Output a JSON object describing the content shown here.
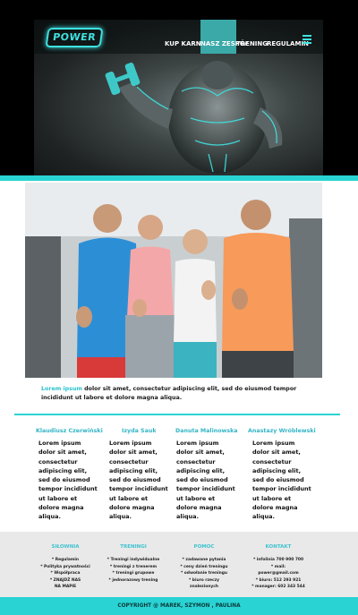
{
  "brand": {
    "logo_text": "POWER",
    "accent": "#2ad3d3"
  },
  "nav": {
    "items": [
      {
        "label": "KUP KARNET"
      },
      {
        "label": "NASZ ZESPÓŁ",
        "active": true
      },
      {
        "label": "TRENING"
      },
      {
        "label": "REGULAMIN"
      }
    ],
    "menu_icon": "hamburger-icon"
  },
  "intro": {
    "lead": "Lorem ipsum",
    "body": " dolor sit amet, consectetur adipiscing elit, sed do eiusmod tempor incididunt ut labore et dolore magna aliqua."
  },
  "team": [
    {
      "name": "Klaudiusz Czerwiński",
      "text": "Lorem ipsum dolor sit amet, consectetur adipiscing elit, sed do eiusmod tempor incididunt ut labore et dolore magna aliqua."
    },
    {
      "name": "Izyda Sauk",
      "text": "Lorem ipsum dolor sit amet, consectetur adipiscing elit, sed do eiusmod tempor incididunt ut labore et dolore magna aliqua."
    },
    {
      "name": "Danuta Malinowska",
      "text": "Lorem ipsum dolor sit amet, consectetur adipiscing elit, sed do eiusmod tempor incididunt ut labore et dolore magna aliqua."
    },
    {
      "name": "Anastazy Wróblewski",
      "text": "Lorem ipsum dolor sit amet, consectetur adipiscing elit, sed do eiusmod tempor incididunt ut labore et dolore magna aliqua."
    }
  ],
  "footer": {
    "columns": [
      {
        "title": "SIŁOWNIA",
        "items": [
          "* Regulamin",
          "* Polityka prywatności",
          "* Współpraca",
          "* ZNAJDŹ NAS NA MAPIE"
        ]
      },
      {
        "title": "TRENINGI",
        "items": [
          "* Treningi indywidualne",
          "* treningi z trenerem",
          "* treningi grupowe",
          "* jednorazowy trening"
        ]
      },
      {
        "title": "POMOC",
        "items": [
          "* zadawane pytania",
          "* ceny dzień treningu",
          "* odwołanie treningu",
          "* biuro rzeczy znalezionych"
        ]
      },
      {
        "title": "KONTAKT",
        "items": [
          "* infolinia 700 900 700",
          "* mail: power@gmail.com",
          "* biuro: 512 293 921",
          "* manager: 602 343 544"
        ]
      }
    ],
    "copyright": "COPYRIGHT @ MAREK, SZYMON , PAULINA"
  }
}
